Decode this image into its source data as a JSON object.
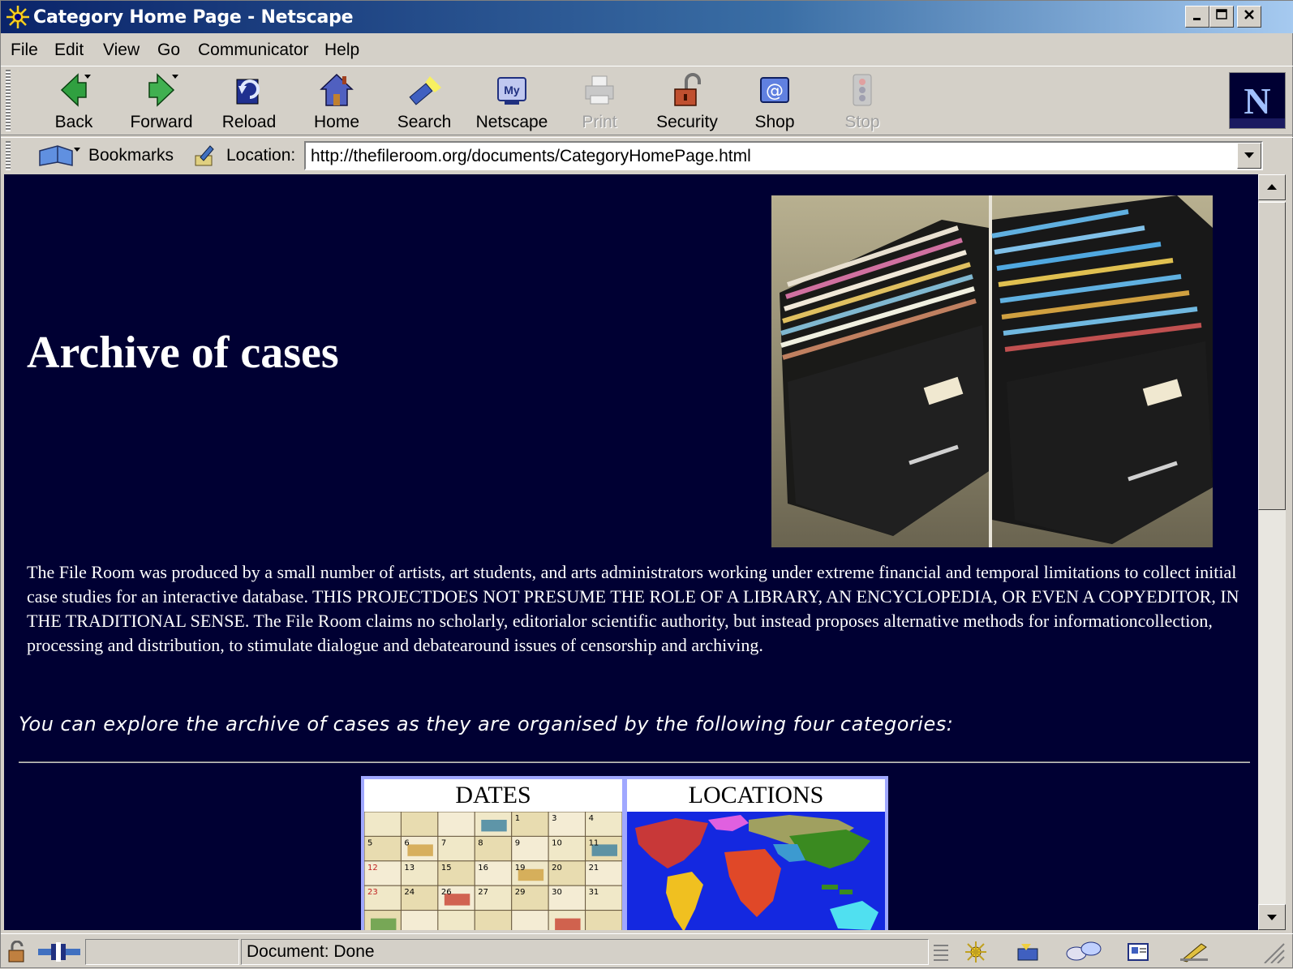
{
  "window": {
    "title": "Category Home Page - Netscape"
  },
  "menu": [
    "File",
    "Edit",
    "View",
    "Go",
    "Communicator",
    "Help"
  ],
  "toolbar": {
    "back": "Back",
    "forward": "Forward",
    "reload": "Reload",
    "home": "Home",
    "search": "Search",
    "netscape": "Netscape",
    "print": "Print",
    "security": "Security",
    "shop": "Shop",
    "stop": "Stop",
    "logo_letter": "N"
  },
  "location_bar": {
    "bookmarks_label": "Bookmarks",
    "location_label": "Location:",
    "url": "http://thefileroom.org/documents/CategoryHomePage.html"
  },
  "page": {
    "background": "#000033",
    "title": "Archive of cases",
    "intro": "The File Room was produced by a small number of artists, art students, and arts administrators working under extreme financial and temporal limitations to collect initial case studies for an interactive database. THIS PROJECTDOES NOT PRESUME THE ROLE OF A LIBRARY, AN ENCYCLOPEDIA, OR EVEN A COPYEDITOR, IN THE TRADITIONAL SENSE. The File Room claims no scholarly, editorialor scientific authority, but instead proposes alternative methods for informationcollection, processing and distribution, to stimulate dialogue and debatearound issues of censorship and archiving.",
    "explore_text": "You can explore the archive of cases as they are organised by the following four categories:",
    "categories": [
      {
        "label": "DATES"
      },
      {
        "label": "LOCATIONS"
      }
    ],
    "calendar_numbers": [
      "1",
      "3",
      "4",
      "5",
      "6",
      "7",
      "8",
      "9",
      "10",
      "11",
      "12",
      "13",
      "15",
      "16",
      "19",
      "20",
      "21",
      "23",
      "24",
      "26",
      "27",
      "29",
      "30",
      "31"
    ]
  },
  "status": {
    "text": "Document: Done"
  }
}
